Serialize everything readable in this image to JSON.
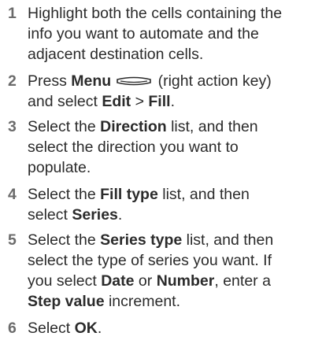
{
  "steps": [
    {
      "number": "1",
      "lines": [
        "Highlight both the cells containing the",
        "info you want to automate and the",
        "adjacent destination cells."
      ]
    },
    {
      "number": "2",
      "press": "Press ",
      "menu": "Menu",
      "key_note": " (right action key)",
      "and_select": "and select ",
      "edit": "Edit",
      "sep": " > ",
      "fill": "Fill",
      "period": "."
    },
    {
      "number": "3",
      "select": "Select the ",
      "bold": "Direction",
      "rest": " list, and then",
      "line2": "select the direction you want to",
      "line3": "populate."
    },
    {
      "number": "4",
      "select": "Select the ",
      "bold": "Fill type",
      "rest": " list, and then",
      "line2_pre": "select ",
      "line2_bold": "Series",
      "period": "."
    },
    {
      "number": "5",
      "select": "Select the ",
      "bold": "Series type",
      "rest": " list, and then",
      "line2": "select the type of series you want. If",
      "line3_pre": "you select ",
      "date": "Date",
      "or": " or ",
      "number_word": "Number",
      "line3_post": ", enter a",
      "step_value": "Step value",
      "increment": " increment."
    },
    {
      "number": "6",
      "select": "Select ",
      "ok": "OK",
      "period": "."
    }
  ],
  "icons": {
    "menu_key": "menu-key-icon"
  }
}
